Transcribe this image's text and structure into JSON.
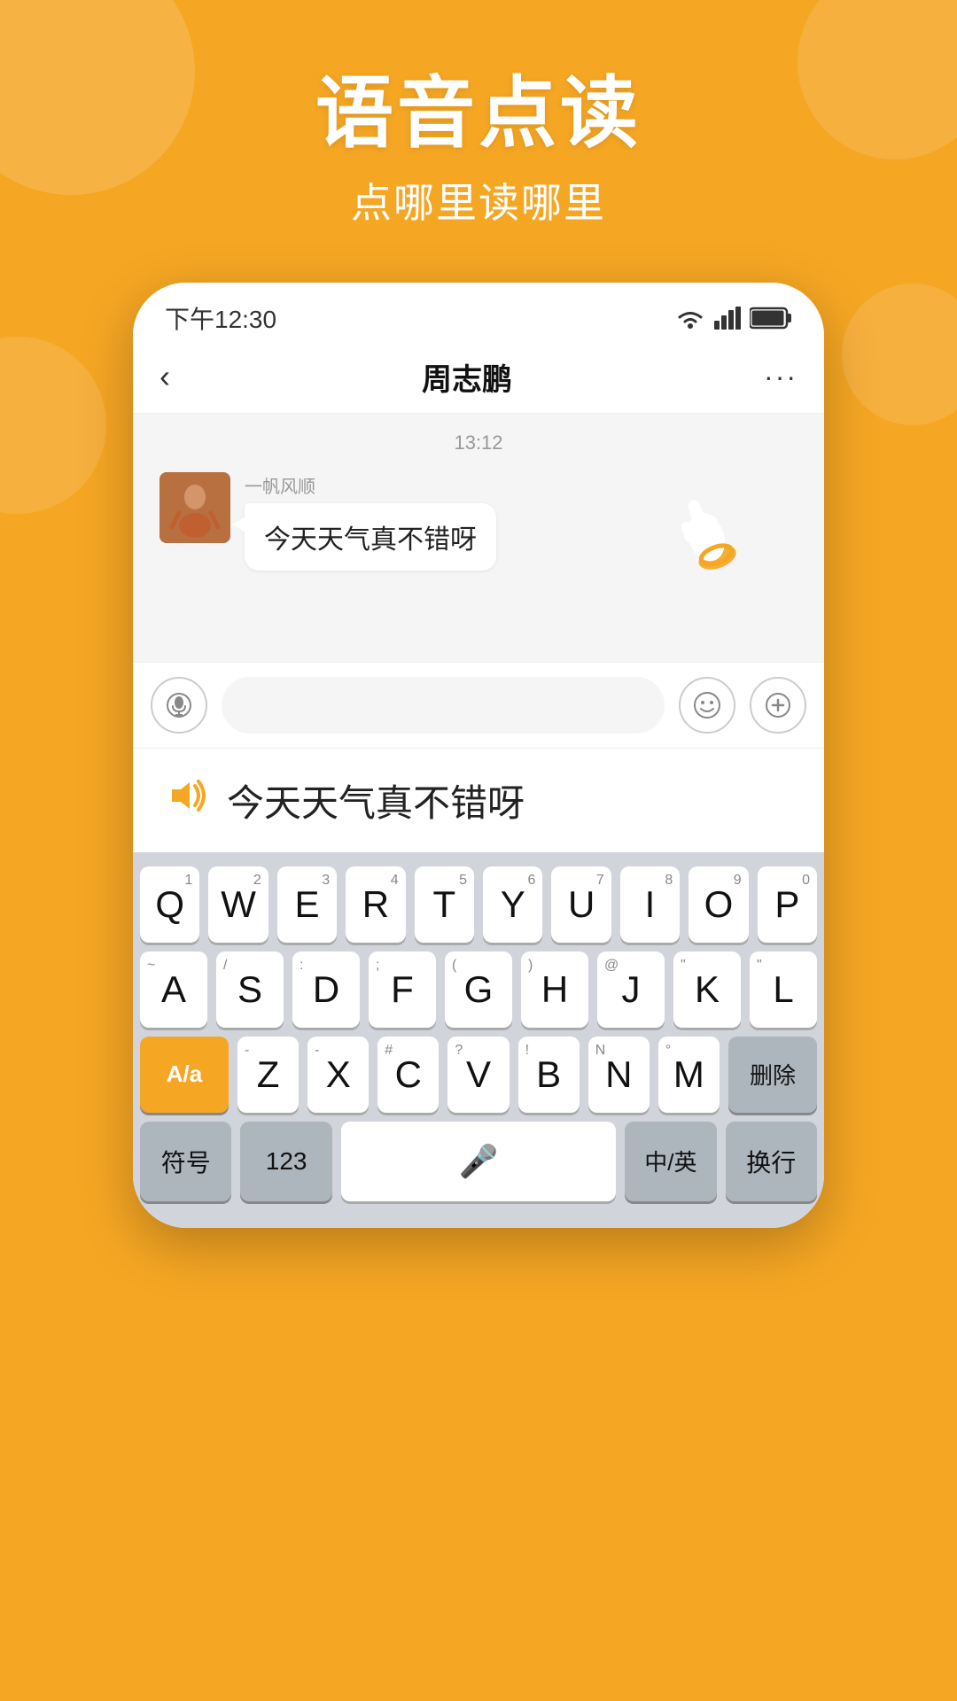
{
  "background": {
    "color": "#F5A623"
  },
  "header": {
    "main_title": "语音点读",
    "sub_title": "点哪里读哪里"
  },
  "phone": {
    "status_bar": {
      "time": "下午12:30",
      "wifi": "wifi",
      "signal": "signal",
      "battery": "battery"
    },
    "nav": {
      "back": "‹",
      "title": "周志鹏",
      "more": "···"
    },
    "chat": {
      "timestamp": "13:12",
      "sender_name": "一帆风顺",
      "message": "今天天气真不错呀"
    },
    "reading_bar": {
      "icon": "🔊",
      "text": "今天天气真不错呀"
    },
    "keyboard": {
      "row1": [
        {
          "letter": "Q",
          "num": "1"
        },
        {
          "letter": "W",
          "num": "2"
        },
        {
          "letter": "E",
          "num": "3"
        },
        {
          "letter": "R",
          "num": "4"
        },
        {
          "letter": "T",
          "num": "5"
        },
        {
          "letter": "Y",
          "num": "6"
        },
        {
          "letter": "U",
          "num": "7"
        },
        {
          "letter": "I",
          "num": "8"
        },
        {
          "letter": "O",
          "num": "9"
        },
        {
          "letter": "P",
          "num": "0"
        }
      ],
      "row2": [
        {
          "letter": "A",
          "sub": "~"
        },
        {
          "letter": "S",
          "sub": "/"
        },
        {
          "letter": "D",
          "sub": ":"
        },
        {
          "letter": "F",
          "sub": ";"
        },
        {
          "letter": "G",
          "sub": "("
        },
        {
          "letter": "H",
          "sub": ")"
        },
        {
          "letter": "J",
          "sub": "@"
        },
        {
          "letter": "K",
          "sub": "\""
        },
        {
          "letter": "L",
          "sub": "\""
        }
      ],
      "row3": [
        {
          "letter": "A/a",
          "special": true,
          "active": true
        },
        {
          "letter": "Z",
          "sub": "-"
        },
        {
          "letter": "X",
          "sub": "-"
        },
        {
          "letter": "C",
          "sub": "#"
        },
        {
          "letter": "V",
          "sub": "?"
        },
        {
          "letter": "B",
          "sub": "!"
        },
        {
          "letter": "N",
          "sub": "N"
        },
        {
          "letter": "M",
          "sub": "°"
        },
        {
          "letter": "删除",
          "special": true
        }
      ],
      "row4": [
        {
          "letter": "符号"
        },
        {
          "letter": "123"
        },
        {
          "letter": "🎤",
          "space": true
        },
        {
          "letter": "中/英"
        },
        {
          "letter": "换行"
        }
      ]
    }
  }
}
